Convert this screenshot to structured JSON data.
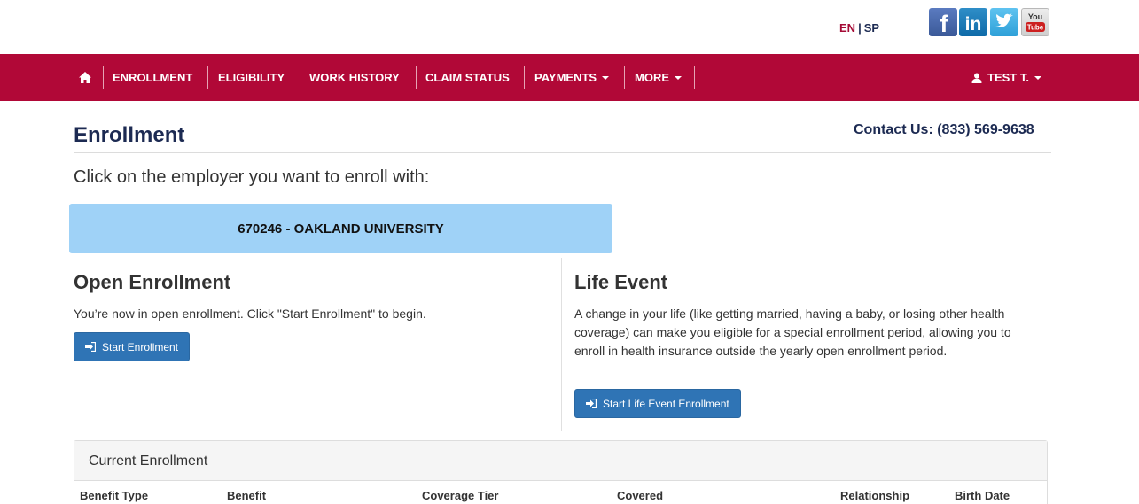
{
  "header": {
    "lang_en": "EN",
    "lang_sep": "|",
    "lang_sp": "SP",
    "social": {
      "facebook": "f",
      "linkedin": "in",
      "youtube_top": "You",
      "youtube_bottom": "Tube"
    }
  },
  "nav": {
    "home_icon": "home-icon",
    "items": [
      {
        "label": "ENROLLMENT"
      },
      {
        "label": "ELIGIBILITY"
      },
      {
        "label": "WORK HISTORY"
      },
      {
        "label": "CLAIM STATUS"
      },
      {
        "label": "PAYMENTS"
      },
      {
        "label": "MORE"
      }
    ],
    "user_label": "TEST T.",
    "bg_color": "#b10837"
  },
  "page": {
    "title": "Enrollment",
    "contact": "Contact Us: (833) 569-9638",
    "instruction": "Click on the employer you want to enroll with:",
    "employer": "670246 - OAKLAND UNIVERSITY"
  },
  "open_enrollment": {
    "title": "Open Enrollment",
    "text": "You’re now in open enrollment. Click \"Start Enrollment\" to begin.",
    "button": "Start Enrollment"
  },
  "life_event": {
    "title": "Life Event",
    "text": "A change in your life (like getting married, having a baby, or losing other health coverage) can make you eligible for a special enrollment period, allowing you to enroll in health insurance outside the yearly open enrollment period.",
    "button": "Start Life Event Enrollment"
  },
  "current_enrollment": {
    "title": "Current Enrollment",
    "columns": [
      "Benefit Type",
      "Benefit",
      "Coverage Tier",
      "Covered",
      "Relationship",
      "Birth Date"
    ]
  }
}
